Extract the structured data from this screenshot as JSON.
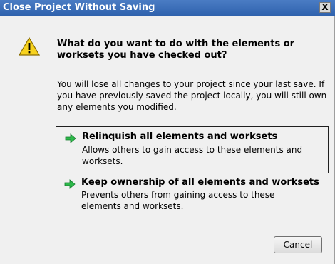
{
  "dialog": {
    "title": "Close Project Without Saving",
    "close_glyph": "X",
    "icon": "warning-icon",
    "main_instruction": "What do you want to do with the elements or worksets you have checked out?",
    "content": "You will lose all changes to your project since your last save. If you have previously saved the project locally, you will still own any elements you modified."
  },
  "commands": [
    {
      "icon": "green-arrow-icon",
      "title": "Relinquish all elements and worksets",
      "description": "Allows others to gain access to these elements and worksets.",
      "selected": true
    },
    {
      "icon": "green-arrow-icon",
      "title": "Keep ownership of all elements and worksets",
      "description": "Prevents others from gaining access to these elements and worksets.",
      "selected": false
    }
  ],
  "buttons": {
    "cancel": "Cancel"
  },
  "colors": {
    "titlebar": "#2f62ad",
    "dialog_bg": "#f0f0f0",
    "warning_yellow": "#f7d21e",
    "arrow_green": "#2db84a"
  }
}
